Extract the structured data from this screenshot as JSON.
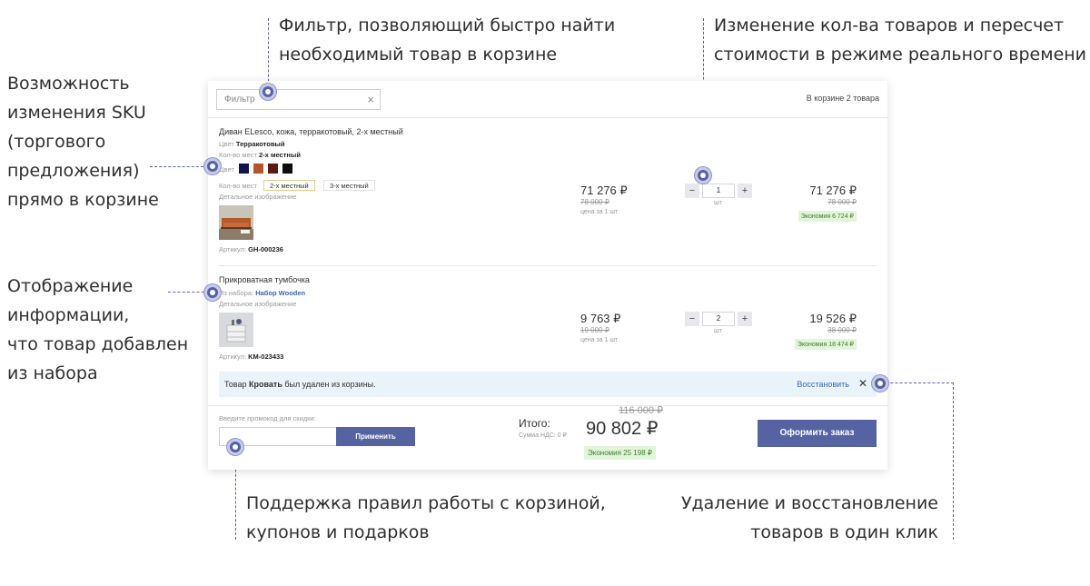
{
  "annotations": {
    "filter": [
      "Фильтр, позволяющий быстро найти",
      "необходимый товар в корзине"
    ],
    "quantity": [
      "Изменение кол-ва товаров и пересчет",
      "стоимости в режиме реального времени"
    ],
    "sku": [
      "Возможность",
      "изменения SKU",
      "(торгового",
      "предложения)",
      "прямо в корзине"
    ],
    "set_info": [
      "Отображение",
      "информации,",
      "что товар добавлен",
      "из набора"
    ],
    "rules": [
      "Поддержка правил работы с корзиной,",
      "купонов и подарков"
    ],
    "remove": [
      "Удаление и восстановление",
      "товаров в один клик"
    ]
  },
  "cart": {
    "filter_placeholder": "Фильтр",
    "filter_clear": "×",
    "count_text": "В корзине 2 товара",
    "items": [
      {
        "name": "Диван ELesco, кожа, терракотовый, 2-х местный",
        "color_label": "Цвет",
        "color_value": "Терракотовый",
        "seats_label": "Кол-во мест",
        "seats_value": "2-х местный",
        "color_swatch_label": "Цвет",
        "swatches": [
          "#12154a",
          "#b4532c",
          "#5a1c10",
          "#0d0d0d"
        ],
        "seats_option_label": "Кол-во мест",
        "options": [
          "2-х местный",
          "3-х местный"
        ],
        "detail_image_label": "Детальное изображение",
        "article_label": "Артикул:",
        "article": "GH-000236",
        "price": "71 276 ₽",
        "old_price": "78 000 ₽",
        "per_unit": "цена за 1 шт",
        "qty": "1",
        "unit": "шт",
        "total": "71 276 ₽",
        "total_old": "78 000 ₽",
        "saving": "Экономия 6 724 ₽"
      },
      {
        "name": "Прикроватная тумбочка",
        "set_label": "Из набора:",
        "set_value": "Набор Wooden",
        "detail_image_label": "Детальное изображение",
        "article_label": "Артикул:",
        "article": "KM-023433",
        "price": "9 763 ₽",
        "old_price": "19 000 ₽",
        "per_unit": "цена за 1 шт",
        "qty": "2",
        "unit": "шт",
        "total": "19 526 ₽",
        "total_old": "38 000 ₽",
        "saving": "Экономия 18 474 ₽"
      }
    ],
    "removed": {
      "prefix": "Товар",
      "item": "Кровать",
      "suffix": "был удален из корзины.",
      "restore": "Восстановить",
      "close": "✕"
    },
    "footer": {
      "promo_label": "Введите промокод для скидки:",
      "apply": "Применить",
      "total_label": "Итого:",
      "vat_label": "Сумма НДС: 0 ₽",
      "total_old": "116 000 ₽",
      "total": "90 802 ₽",
      "saving": "Экономия 25 198 ₽",
      "order": "Оформить заказ"
    },
    "qty_minus": "−",
    "qty_plus": "+"
  }
}
